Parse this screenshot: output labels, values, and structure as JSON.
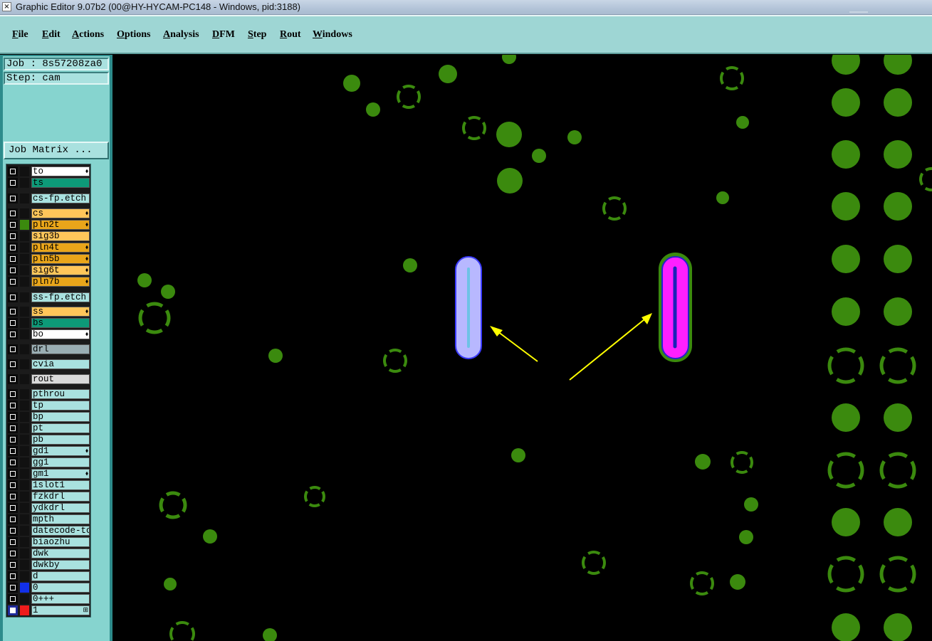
{
  "window": {
    "title": "Graphic Editor 9.07b2 (00@HY-HYCAM-PC148 - Windows, pid:3188)",
    "icon": "app-icon"
  },
  "menu": [
    "File",
    "Edit",
    "Actions",
    "Options",
    "Analysis",
    "DFM",
    "Step",
    "Rout",
    "Windows"
  ],
  "job": {
    "job_text": "Job : 8s57208za0",
    "step_text": "Step: cam",
    "matrix_button": "Job Matrix ..."
  },
  "layers": [
    {
      "name": "to",
      "color": "#ffffff",
      "marked": true
    },
    {
      "name": "ts",
      "color": "#0d9a78",
      "marked": false
    },
    {
      "name": "cs-fp.etch",
      "color": "#a9e1df",
      "marked": false
    },
    {
      "name": "cs",
      "color": "#ffc65a",
      "marked": true
    },
    {
      "name": "pln2t",
      "color": "#e9a51a",
      "marked": true,
      "active": true
    },
    {
      "name": "sig3b",
      "color": "#ffc65a",
      "marked": false
    },
    {
      "name": "pln4t",
      "color": "#e9a51a",
      "marked": true
    },
    {
      "name": "pln5b",
      "color": "#e9a51a",
      "marked": true
    },
    {
      "name": "sig6t",
      "color": "#ffc65a",
      "marked": true
    },
    {
      "name": "pln7b",
      "color": "#e9a51a",
      "marked": true
    },
    {
      "name": "ss-fp.etch",
      "color": "#a9e1df",
      "marked": false
    },
    {
      "name": "ss",
      "color": "#ffc65a",
      "marked": true
    },
    {
      "name": "bs",
      "color": "#0d9a78",
      "marked": false
    },
    {
      "name": "bo",
      "color": "#ffffff",
      "marked": true
    },
    {
      "name": "drl",
      "color": "#9aaeb3",
      "marked": false
    },
    {
      "name": "cvia",
      "color": "#a9e1df",
      "marked": false
    },
    {
      "name": "rout",
      "color": "#d9d9d9",
      "marked": false
    },
    {
      "name": "pthrou",
      "color": "#a9e1df",
      "marked": false
    },
    {
      "name": "tp",
      "color": "#a9e1df",
      "marked": false
    },
    {
      "name": "bp",
      "color": "#a9e1df",
      "marked": false
    },
    {
      "name": "pt",
      "color": "#a9e1df",
      "marked": false
    },
    {
      "name": "pb",
      "color": "#a9e1df",
      "marked": false
    },
    {
      "name": "gd1",
      "color": "#a9e1df",
      "marked": true
    },
    {
      "name": "gg1",
      "color": "#a9e1df",
      "marked": false
    },
    {
      "name": "gm1",
      "color": "#a9e1df",
      "marked": true
    },
    {
      "name": "1slot1",
      "color": "#a9e1df",
      "marked": false
    },
    {
      "name": "fzkdrl",
      "color": "#a9e1df",
      "marked": false
    },
    {
      "name": "ydkdrl",
      "color": "#a9e1df",
      "marked": false
    },
    {
      "name": "mpth",
      "color": "#a9e1df",
      "marked": false
    },
    {
      "name": "datecode-to",
      "color": "#a9e1df",
      "marked": false
    },
    {
      "name": "biaozhu",
      "color": "#a9e1df",
      "marked": false
    },
    {
      "name": "dwk",
      "color": "#a9e1df",
      "marked": false
    },
    {
      "name": "dwkby",
      "color": "#a9e1df",
      "marked": false
    },
    {
      "name": "d",
      "color": "#a9e1df",
      "marked": false
    },
    {
      "name": "0",
      "color": "#a9e1df",
      "marked": false,
      "display_color": "#1230e8"
    },
    {
      "name": "0+++",
      "color": "#a9e1df",
      "marked": false
    },
    {
      "name": "1",
      "color": "#a9e1df",
      "marked": false,
      "display_color": "#ee1c1c",
      "selected": true,
      "extra_mark": "grid-icon"
    }
  ],
  "icons": {
    "marked": "edit-mark-icon"
  },
  "colors": {
    "pad": "#3b8a0e",
    "arrow": "#ffff00",
    "slot_highlight": "#ff1fff",
    "slot_light": "#b8b8ff"
  }
}
